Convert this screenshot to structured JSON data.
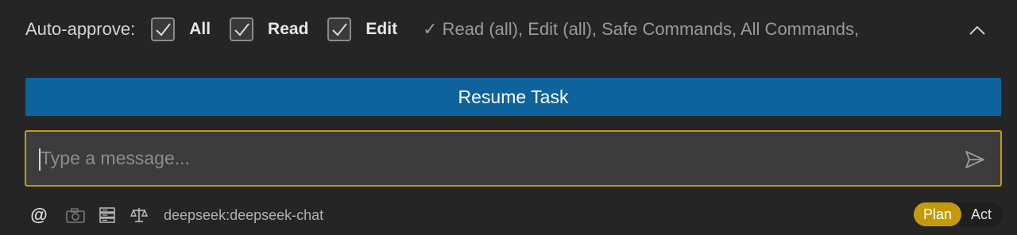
{
  "auto_approve": {
    "label": "Auto-approve:",
    "options": [
      {
        "label": "All",
        "checked": true
      },
      {
        "label": "Read",
        "checked": true
      },
      {
        "label": "Edit",
        "checked": true
      }
    ],
    "summary": "✓ Read (all), Edit (all), Safe Commands, All Commands,",
    "collapse_icon": "chevron-up-icon"
  },
  "resume": {
    "label": "Resume Task"
  },
  "message": {
    "placeholder": "Type a message...",
    "value": "",
    "send_icon": "send-icon"
  },
  "toolbar": {
    "icons": [
      "at-mention-icon",
      "camera-icon",
      "server-icon",
      "scale-icon"
    ],
    "model": "deepseek:deepseek-chat"
  },
  "mode": {
    "plan_label": "Plan",
    "act_label": "Act",
    "selected": "Plan"
  },
  "colors": {
    "background": "#252526",
    "primary_button": "#0e639c",
    "accent": "#c49a0b"
  }
}
